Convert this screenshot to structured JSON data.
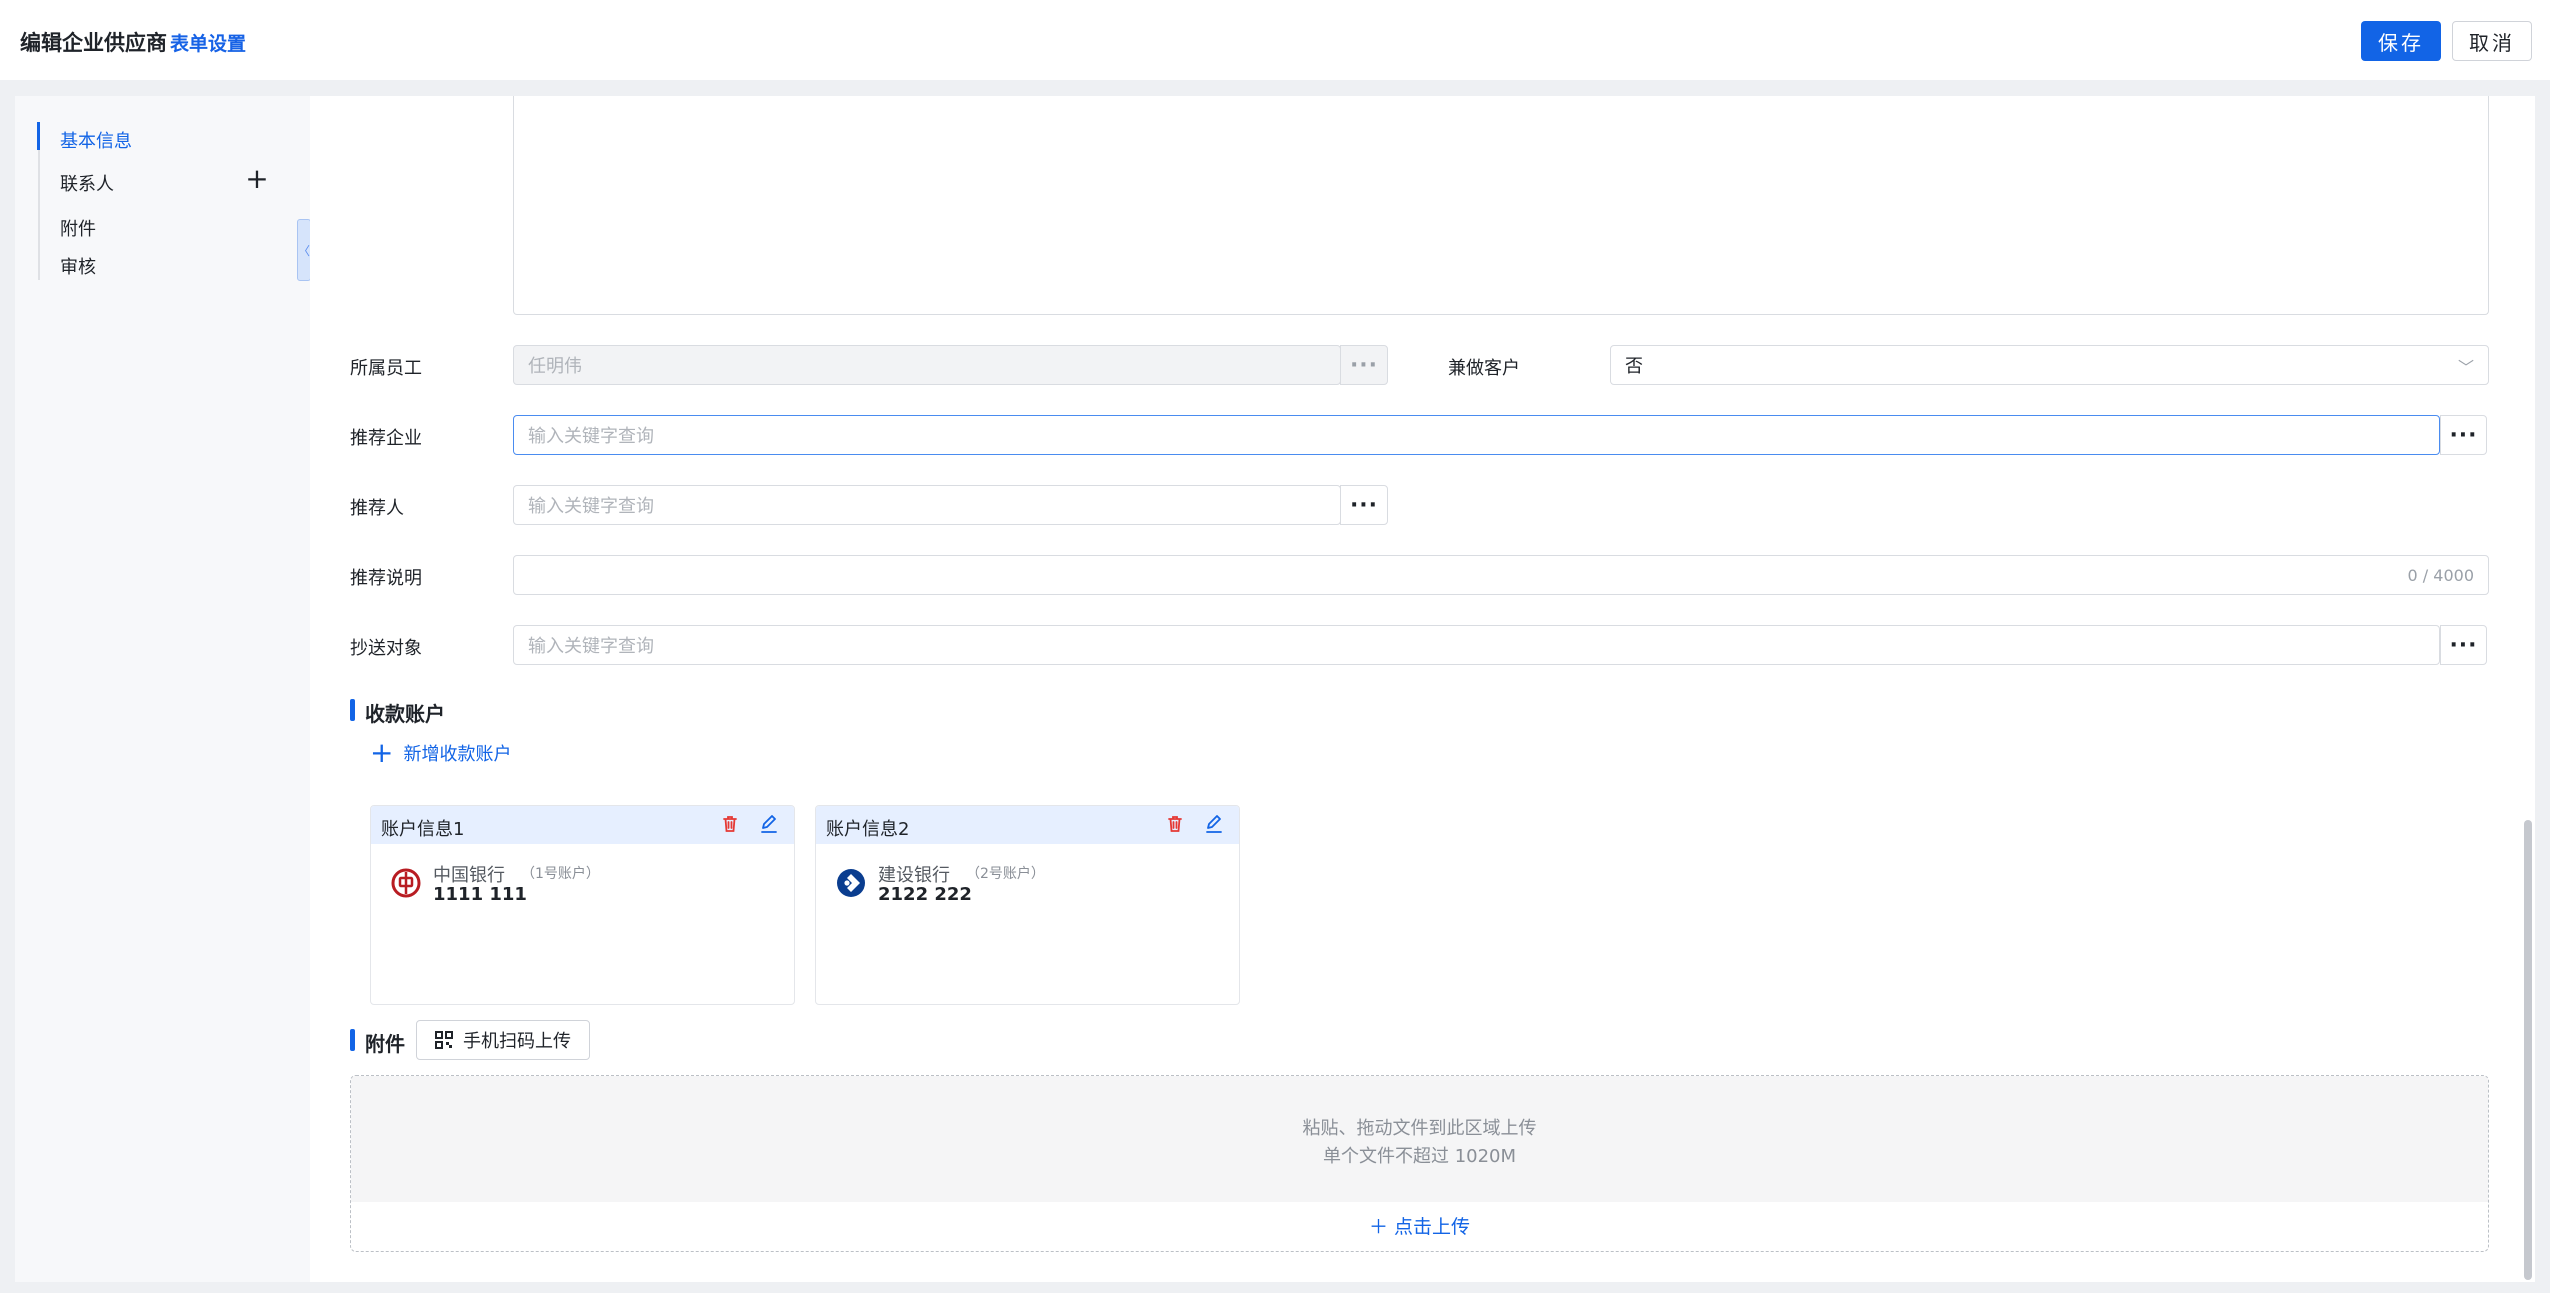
{
  "header": {
    "title": "编辑企业供应商",
    "form_settings": "表单设置",
    "save_label": "保存",
    "cancel_label": "取消"
  },
  "sidebar": {
    "items": [
      {
        "label": "基本信息",
        "active": true
      },
      {
        "label": "联系人",
        "has_add": true
      },
      {
        "label": "附件"
      },
      {
        "label": "审核"
      }
    ],
    "add_icon": "plus-icon",
    "collapse_icon": "chevron-left-icon"
  },
  "form": {
    "employee": {
      "label": "所属员工",
      "value": "任明伟"
    },
    "also_customer": {
      "label": "兼做客户",
      "value": "否"
    },
    "referrer_company": {
      "label": "推荐企业",
      "placeholder": "输入关键字查询"
    },
    "referrer": {
      "label": "推荐人",
      "placeholder": "输入关键字查询"
    },
    "referral_note": {
      "label": "推荐说明",
      "counter": "0 / 4000"
    },
    "cc_target": {
      "label": "抄送对象",
      "placeholder": "输入关键字查询"
    },
    "dots": "···"
  },
  "accounts": {
    "section_title": "收款账户",
    "add_label": "新增收款账户",
    "cards": [
      {
        "title": "账户信息1",
        "bank": "中国银行",
        "tag": "（1号账户）",
        "number": "1111 111",
        "logo": "bank-of-china-logo",
        "logo_color": "#b81c22"
      },
      {
        "title": "账户信息2",
        "bank": "建设银行",
        "tag": "（2号账户）",
        "number": "2122 222",
        "logo": "ccb-logo",
        "logo_color": "#0a3d8f"
      }
    ]
  },
  "attachments": {
    "section_title": "附件",
    "scan_label": "手机扫码上传",
    "drop_hint": "粘贴、拖动文件到此区域上传",
    "size_hint": "单个文件不超过 1020M",
    "click_upload": "点击上传"
  },
  "colors": {
    "accent": "#1264e6",
    "danger": "#e53935"
  }
}
